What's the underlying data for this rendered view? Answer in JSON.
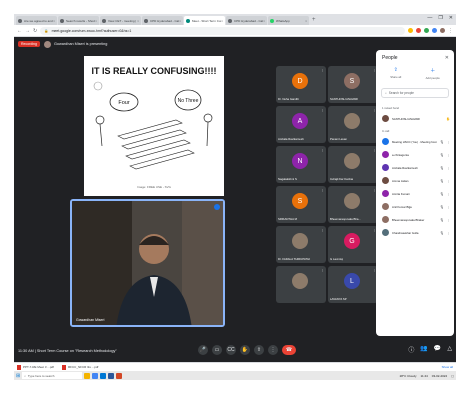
{
  "browser": {
    "tabs": [
      "Are we agreed to and tie...",
      "Search results - Shodhganga",
      "View CET - meeting | Heal",
      "CPD Hyderabad - Calendar",
      "Meet - Short Term Course",
      "CPD Hyderabad - Calendar - Q",
      "WhatsApp"
    ],
    "active_tab": 4,
    "url": "meet.google.com/rum-xwuo-hmf?authuser=0&hs=1",
    "window_controls": [
      "—",
      "❐",
      "✕"
    ]
  },
  "meet": {
    "recording_label": "Recording",
    "presenter_text": "Gowardhan Miseri is presenting",
    "slide": {
      "title": "IT IS REALLY CONFUSING!!!!",
      "bubble_left": "Four",
      "bubble_right": "No Three",
      "caption": "Image: FREE USE - SVG"
    },
    "main_video_name": "Gowardhan Miseri",
    "tiles": [
      {
        "initial": "D",
        "name": "Dr. Neha Gandhi",
        "color": "#e8710a",
        "photo": false
      },
      {
        "initial": "S",
        "name": "SANTHOSH ANAVARI",
        "color": "#8d6e63",
        "photo": false
      },
      {
        "initial": "A",
        "name": "Ambala Ravikarnesh",
        "color": "#8e24aa",
        "photo": false
      },
      {
        "initial": "",
        "name": "Pavani Lavan",
        "color": "",
        "photo": true
      },
      {
        "initial": "N",
        "name": "Nagalakshmi S",
        "color": "#8e24aa",
        "photo": false
      },
      {
        "initial": "",
        "name": "Indrajit Kar Kanhar",
        "color": "",
        "photo": true
      },
      {
        "initial": "S",
        "name": "SRIKANTHA M",
        "color": "#e8710a",
        "photo": false
      },
      {
        "initial": "",
        "name": "Bheemaraopuvala Bha...",
        "color": "",
        "photo": true
      },
      {
        "initial": "",
        "name": "Dr. FADALA THIRUPATHI",
        "color": "",
        "photo": true
      },
      {
        "initial": "G",
        "name": "G Laxmisp",
        "color": "#d81b60",
        "photo": false
      },
      {
        "initial": "",
        "name": "",
        "color": "",
        "photo": true
      },
      {
        "initial": "L",
        "name": "LAVANYA SP",
        "color": "#3949ab",
        "photo": false
      }
    ],
    "meeting_info": "11:30 AM  |  Short Term Course on \"Research Methodology\"",
    "controls": [
      "mic",
      "camera",
      "cc",
      "hand",
      "present",
      "more"
    ],
    "right_controls": [
      "info-icon",
      "people-icon",
      "chat-icon",
      "activities-icon"
    ]
  },
  "people_panel": {
    "title": "People",
    "actions": [
      "Share all",
      "Add people"
    ],
    "search_placeholder": "Search for people",
    "section_raised": "1 raised hand",
    "raised_person": "SANTHOSH ANAVARI",
    "section_incall": "In call",
    "people": [
      {
        "name": "Meeting HSCC (You) · Meeting host",
        "color": "#1a73e8"
      },
      {
        "name": "a.chintagunta",
        "color": "#8e24aa"
      },
      {
        "name": "Ambala Ravikarnesh",
        "color": "#5e35b1"
      },
      {
        "name": "Amma Jattan",
        "color": "#6d4c41"
      },
      {
        "name": "Amrita Kumari",
        "color": "#8e24aa"
      },
      {
        "name": "Anil Kumar Bijja",
        "color": "#8d6e63"
      },
      {
        "name": "Bheemaraopuvala Bhaker",
        "color": "#8d6e63"
      },
      {
        "name": "Chandrasekhar Golla",
        "color": "#546e7a"
      }
    ]
  },
  "downloads": [
    {
      "name": "PPT-7-RE Meet 3 ...pdf"
    },
    {
      "name": "RFCC_NFCR lits ...pdf"
    }
  ],
  "downloads_show_all": "Show all",
  "taskbar": {
    "search_placeholder": "Type here to search",
    "weather": "28°C Cloudy",
    "time": "11:44",
    "date": "03-02-2022"
  }
}
